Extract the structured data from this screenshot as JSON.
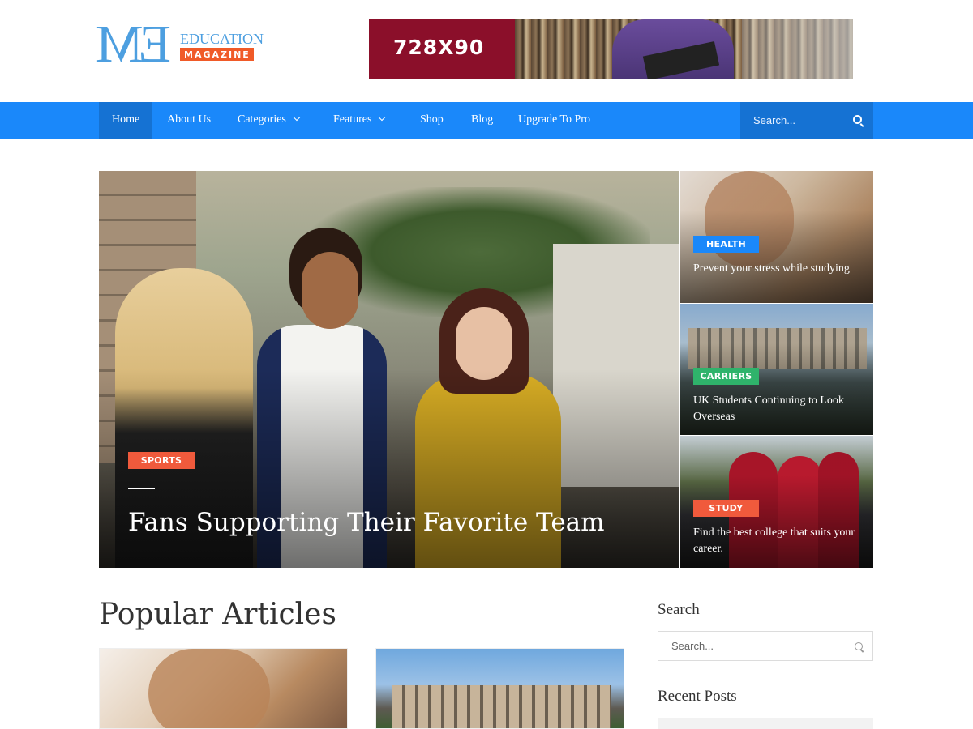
{
  "site": {
    "logo_letters": "EM",
    "logo_word1": "EDUCATION",
    "logo_word2": "MAGAZINE"
  },
  "banner": {
    "text": "728X90"
  },
  "nav": {
    "items": [
      {
        "label": "Home",
        "active": true,
        "has_dropdown": false
      },
      {
        "label": "About Us",
        "active": false,
        "has_dropdown": false
      },
      {
        "label": "Categories",
        "active": false,
        "has_dropdown": true
      },
      {
        "label": "Features",
        "active": false,
        "has_dropdown": true
      },
      {
        "label": "Shop",
        "active": false,
        "has_dropdown": false
      },
      {
        "label": "Blog",
        "active": false,
        "has_dropdown": false
      },
      {
        "label": "Upgrade To Pro",
        "active": false,
        "has_dropdown": false
      }
    ],
    "search_placeholder": "Search..."
  },
  "hero": {
    "tag": "SPORTS",
    "title": "Fans Supporting Their Favorite Team"
  },
  "side_posts": [
    {
      "tag": "HEALTH",
      "tag_color": "#1a88fa",
      "title": "Prevent your stress while studying"
    },
    {
      "tag": "CARRIERS",
      "tag_color": "#2fb36b",
      "title": "UK Students Continuing to Look Overseas"
    },
    {
      "tag": "STUDY",
      "tag_color": "#f05a3c",
      "title": "Find the best college that suits your career."
    }
  ],
  "main": {
    "section_title": "Popular Articles"
  },
  "sidebar": {
    "search_title": "Search",
    "search_placeholder": "Search...",
    "recent_title": "Recent Posts"
  },
  "colors": {
    "accent": "#1a88fa",
    "accent_dark": "#1572d3",
    "logo_blue": "#4d9fe0",
    "logo_orange": "#f05a28"
  }
}
